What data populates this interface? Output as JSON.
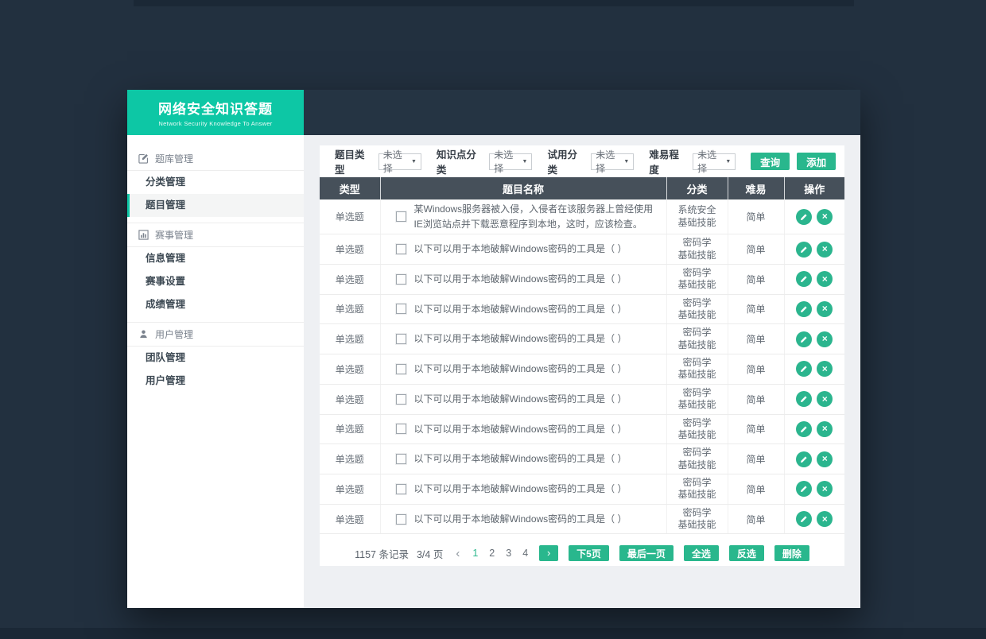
{
  "app": {
    "title": "网络安全知识答题",
    "subtitle": "Network Security Knowledge To Answer"
  },
  "colors": {
    "brand_teal": "#0DC7A5",
    "accent_green": "#29B78D",
    "table_header_bg": "#46505A",
    "page_background": "#22303F",
    "active_item_bar": "#0FC7A6"
  },
  "sidebar": {
    "sections": [
      {
        "label": "题库管理",
        "icon": "edit-note-icon",
        "name": "question-bank-management",
        "items": [
          {
            "label": "分类管理",
            "name": "category-management",
            "active": false
          },
          {
            "label": "题目管理",
            "name": "question-management",
            "active": true
          }
        ]
      },
      {
        "label": "赛事管理",
        "icon": "bar-chart-icon",
        "name": "competition-management",
        "items": [
          {
            "label": "信息管理",
            "name": "info-management",
            "active": false
          },
          {
            "label": "赛事设置",
            "name": "competition-settings",
            "active": false
          },
          {
            "label": "成绩管理",
            "name": "score-management",
            "active": false
          }
        ]
      },
      {
        "label": "用户管理",
        "icon": "user-icon",
        "name": "user-management-section",
        "items": [
          {
            "label": "团队管理",
            "name": "team-management",
            "active": false
          },
          {
            "label": "用户管理",
            "name": "user-management",
            "active": false
          }
        ]
      }
    ]
  },
  "filters": [
    {
      "label": "题目类型",
      "value": "未选择",
      "name": "question-type"
    },
    {
      "label": "知识点分类",
      "value": "未选择",
      "name": "knowledge-point-category"
    },
    {
      "label": "试用分类",
      "value": "未选择",
      "name": "trial-category"
    },
    {
      "label": "难易程度",
      "value": "未选择",
      "name": "difficulty-level"
    }
  ],
  "toolbar": {
    "query_label": "查询",
    "add_label": "添加"
  },
  "table": {
    "headers": [
      "类型",
      "题目名称",
      "分类",
      "难易",
      "操作"
    ],
    "rows": [
      {
        "type": "单选题",
        "title": "某Windows服务器被入侵，入侵者在该服务器上曾经使用IE浏览站点并下载恶意程序到本地，这时，应该检查。",
        "category": [
          "系统安全",
          "基础技能"
        ],
        "difficulty": "简单",
        "checked": false
      },
      {
        "type": "单选题",
        "title": "以下可以用于本地破解Windows密码的工具是（ ）",
        "category": [
          "密码学",
          "基础技能"
        ],
        "difficulty": "简单",
        "checked": false
      },
      {
        "type": "单选题",
        "title": "以下可以用于本地破解Windows密码的工具是（ ）",
        "category": [
          "密码学",
          "基础技能"
        ],
        "difficulty": "简单",
        "checked": false
      },
      {
        "type": "单选题",
        "title": "以下可以用于本地破解Windows密码的工具是（ ）",
        "category": [
          "密码学",
          "基础技能"
        ],
        "difficulty": "简单",
        "checked": false
      },
      {
        "type": "单选题",
        "title": "以下可以用于本地破解Windows密码的工具是（ ）",
        "category": [
          "密码学",
          "基础技能"
        ],
        "difficulty": "简单",
        "checked": false
      },
      {
        "type": "单选题",
        "title": "以下可以用于本地破解Windows密码的工具是（ ）",
        "category": [
          "密码学",
          "基础技能"
        ],
        "difficulty": "简单",
        "checked": false
      },
      {
        "type": "单选题",
        "title": "以下可以用于本地破解Windows密码的工具是（ ）",
        "category": [
          "密码学",
          "基础技能"
        ],
        "difficulty": "简单",
        "checked": false
      },
      {
        "type": "单选题",
        "title": "以下可以用于本地破解Windows密码的工具是（ ）",
        "category": [
          "密码学",
          "基础技能"
        ],
        "difficulty": "简单",
        "checked": false
      },
      {
        "type": "单选题",
        "title": "以下可以用于本地破解Windows密码的工具是（ ）",
        "category": [
          "密码学",
          "基础技能"
        ],
        "difficulty": "简单",
        "checked": false
      },
      {
        "type": "单选题",
        "title": "以下可以用于本地破解Windows密码的工具是（ ）",
        "category": [
          "密码学",
          "基础技能"
        ],
        "difficulty": "简单",
        "checked": false
      },
      {
        "type": "单选题",
        "title": "以下可以用于本地破解Windows密码的工具是（ ）",
        "category": [
          "密码学",
          "基础技能"
        ],
        "difficulty": "简单",
        "checked": false
      }
    ],
    "row_actions": [
      {
        "name": "edit-button",
        "icon": "pencil-icon"
      },
      {
        "name": "delete-button",
        "icon": "close-icon",
        "glyph": "×"
      }
    ]
  },
  "pagination": {
    "records_text": "1157 条记录",
    "page_text": "3/4 页",
    "prev_label": "‹",
    "next_label": "›",
    "pages": [
      {
        "label": "1",
        "active": true
      },
      {
        "label": "2",
        "active": false
      },
      {
        "label": "3",
        "active": false
      },
      {
        "label": "4",
        "active": false
      }
    ],
    "actions": [
      {
        "label": "下5页",
        "name": "next-5-pages-button"
      },
      {
        "label": "最后一页",
        "name": "last-page-button"
      },
      {
        "label": "全选",
        "name": "select-all-button"
      },
      {
        "label": "反选",
        "name": "invert-selection-button"
      },
      {
        "label": "删除",
        "name": "delete-selected-button"
      }
    ]
  }
}
